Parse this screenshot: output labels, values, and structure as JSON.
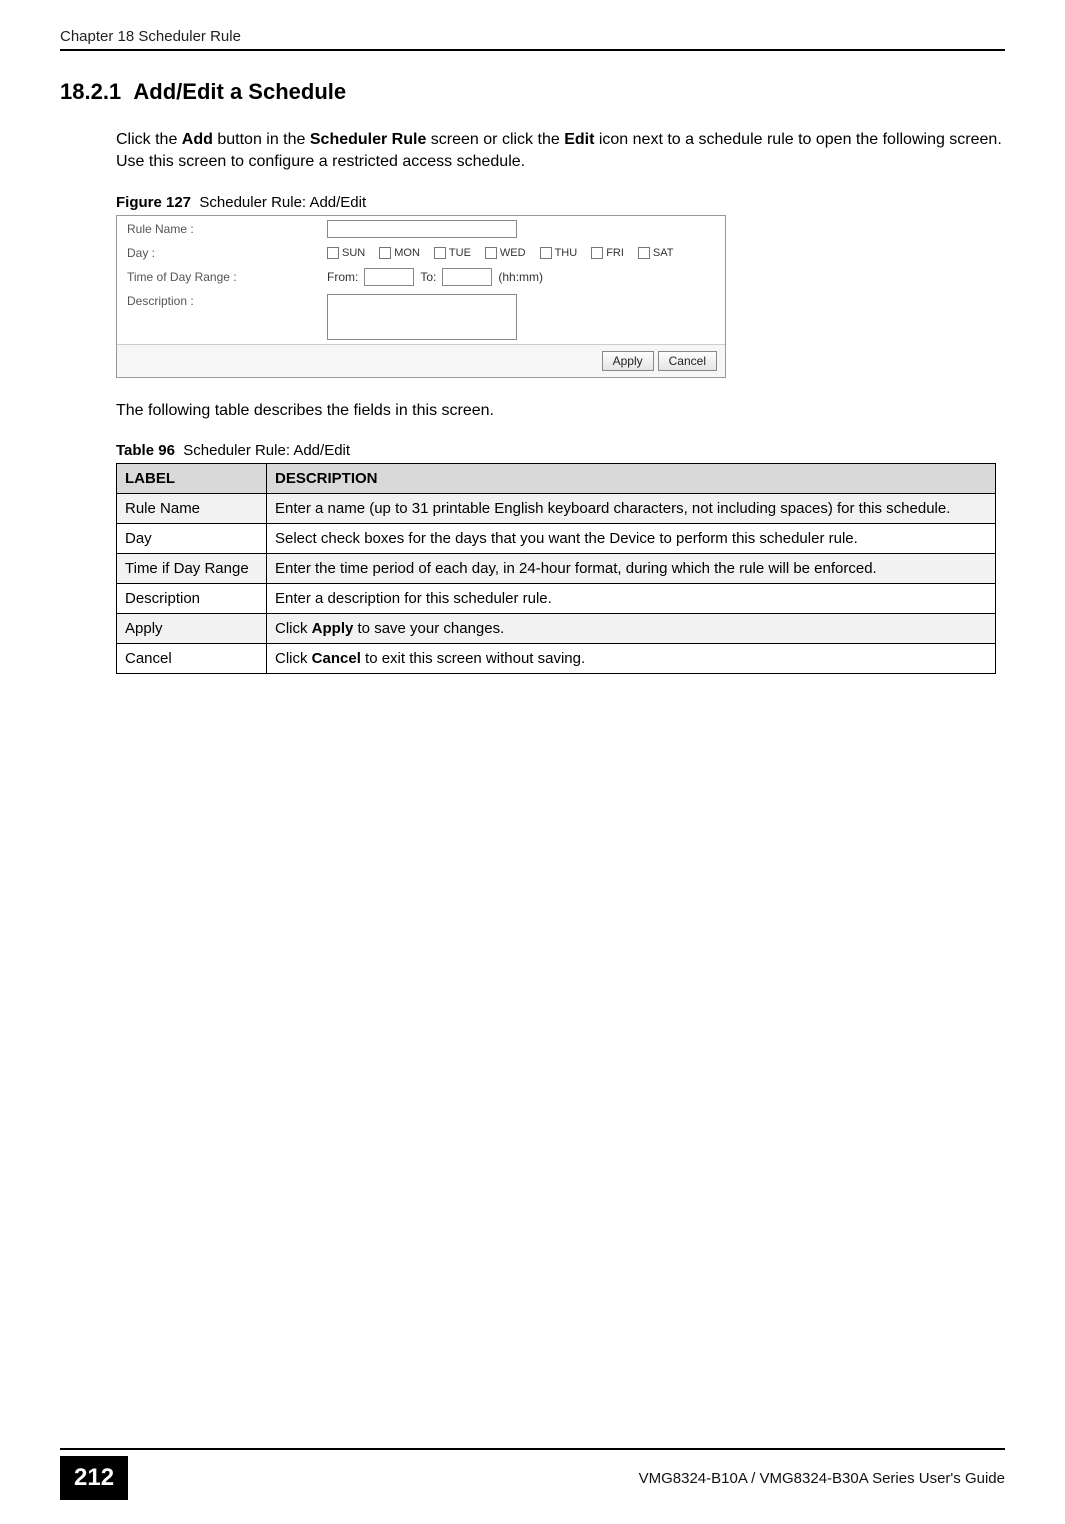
{
  "header": {
    "chapter_line": "Chapter 18 Scheduler Rule"
  },
  "section": {
    "number": "18.2.1",
    "title": "Add/Edit a Schedule"
  },
  "paragraphs": {
    "intro_pre": "Click the ",
    "intro_bold1": "Add",
    "intro_mid1": " button in the ",
    "intro_bold2": "Scheduler Rule",
    "intro_mid2": " screen or click the ",
    "intro_bold3": "Edit",
    "intro_mid3": " icon next to a schedule rule to open the following screen. Use this screen to configure a restricted access schedule.",
    "post_figure": "The following table describes the fields in this screen."
  },
  "figure": {
    "label": "Figure 127",
    "caption": "Scheduler Rule: Add/Edit",
    "labels": {
      "rule_name": "Rule Name :",
      "day": "Day :",
      "time_range": "Time of Day Range :",
      "description": "Description :",
      "from": "From:",
      "to": "To:",
      "hhmm": "(hh:mm)"
    },
    "days": {
      "sun": "SUN",
      "mon": "MON",
      "tue": "TUE",
      "wed": "WED",
      "thu": "THU",
      "fri": "FRI",
      "sat": "SAT"
    },
    "buttons": {
      "apply": "Apply",
      "cancel": "Cancel"
    }
  },
  "table": {
    "label": "Table 96",
    "caption": "Scheduler Rule: Add/Edit",
    "headers": {
      "label": "LABEL",
      "description": "DESCRIPTION"
    },
    "rows": [
      {
        "label": "Rule Name",
        "desc": "Enter a name (up to 31 printable English keyboard characters, not including spaces) for this schedule."
      },
      {
        "label": "Day",
        "desc": "Select check boxes for the days that you want the Device to perform this scheduler rule."
      },
      {
        "label": "Time if Day Range",
        "desc": "Enter the time period of each day, in 24-hour format, during which the rule will be enforced."
      },
      {
        "label": "Description",
        "desc": "Enter a description for this scheduler rule."
      },
      {
        "label": "Apply",
        "desc_pre": "Click ",
        "desc_bold": "Apply",
        "desc_post": " to save your changes."
      },
      {
        "label": "Cancel",
        "desc_pre": "Click ",
        "desc_bold": "Cancel",
        "desc_post": " to exit this screen without saving."
      }
    ]
  },
  "footer": {
    "page_number": "212",
    "guide": "VMG8324-B10A / VMG8324-B30A Series User's Guide"
  }
}
